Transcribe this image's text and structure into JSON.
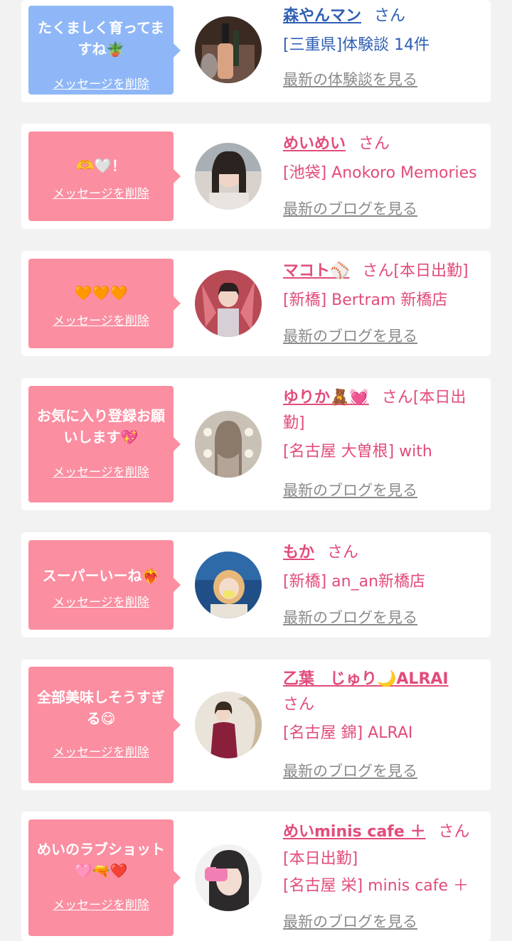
{
  "colors": {
    "page_bg": "#f2f2f2",
    "card_bg": "#ffffff",
    "bubble_blue": "#8fb7f7",
    "bubble_pink": "#fb8ea1",
    "name_pink": "#e24c7a",
    "name_blue": "#2f5fb3",
    "link_gray": "#8a8a8a"
  },
  "delete_label": "メッセージを削除",
  "san": "さん",
  "cards": [
    {
      "message": "たくましく育ってますね🪴",
      "name": "森やんマン",
      "status": "",
      "detail": "[三重県]体験談 14件",
      "latest": "最新の体験談を見る"
    },
    {
      "message": "🫶🤍！",
      "name": "めいめい",
      "status": "",
      "detail": "[池袋] Anokoro Memories",
      "latest": "最新のブログを見る"
    },
    {
      "message": "🧡🧡🧡",
      "name": "マコト⚾",
      "status": "[本日出勤]",
      "detail": "[新橋] Bertram 新橋店",
      "latest": "最新のブログを見る"
    },
    {
      "message": "お気に入り登録お願いします💖",
      "name": "ゆりか🧸💓",
      "status": "[本日出勤]",
      "detail": "[名古屋 大曽根] with",
      "latest": "最新のブログを見る"
    },
    {
      "message": "スーパーいーね❤️‍🔥",
      "name": "もか",
      "status": "",
      "detail": "[新橋] an_an新橋店",
      "latest": "最新のブログを見る"
    },
    {
      "message": "全部美味しそうすぎる😋",
      "name": "乙葉　じゅり🌙ALRAI",
      "status": "",
      "detail": "[名古屋 錦] ALRAI",
      "latest": "最新のブログを見る"
    },
    {
      "message": "めいのラブショット🩷🔫❤️",
      "name": "めいminis cafe ＋",
      "status": "[本日出勤]",
      "detail": "[名古屋 栄] minis cafe ＋",
      "latest": "最新のブログを見る"
    }
  ]
}
